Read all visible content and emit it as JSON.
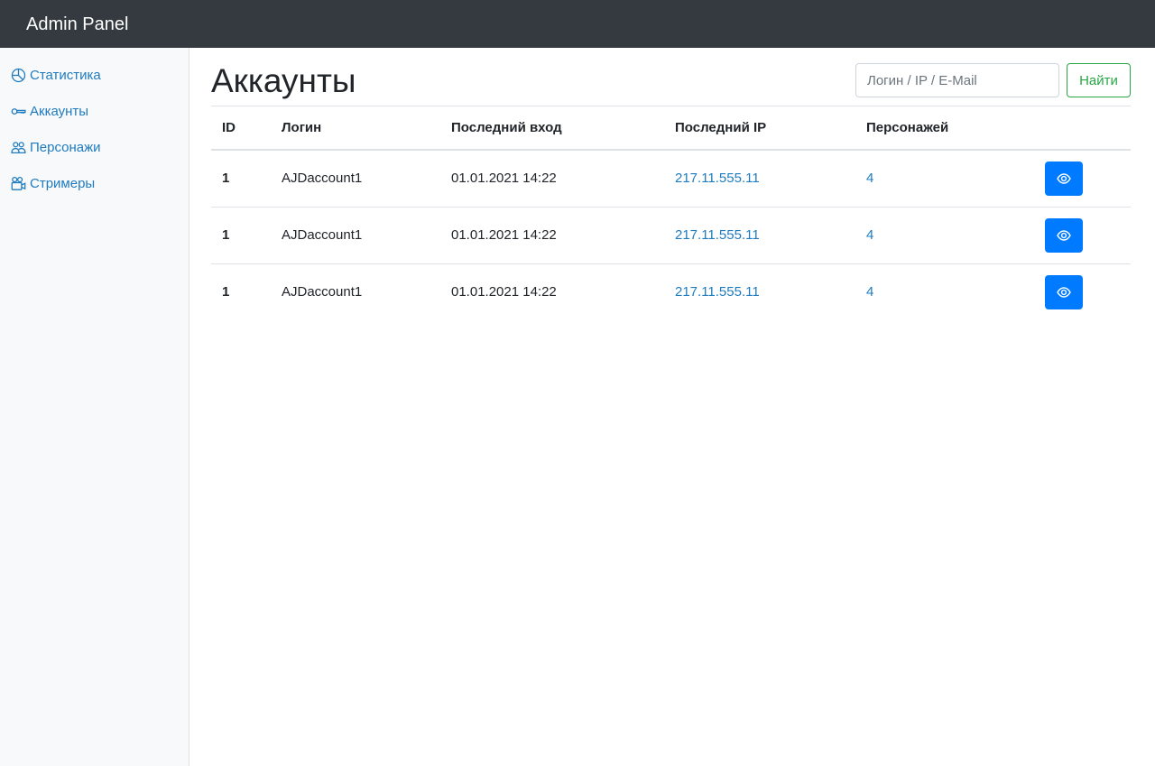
{
  "navbar": {
    "brand": "Admin Panel"
  },
  "sidebar": {
    "items": [
      {
        "label": "Статистика",
        "icon": "pie-chart-icon"
      },
      {
        "label": "Аккаунты",
        "icon": "key-icon"
      },
      {
        "label": "Персонажи",
        "icon": "people-icon"
      },
      {
        "label": "Стримеры",
        "icon": "camera-reels-icon"
      }
    ]
  },
  "main": {
    "title": "Аккаунты",
    "search": {
      "placeholder": "Логин / IP / E-Mail",
      "value": "",
      "button_label": "Найти"
    },
    "table": {
      "headers": [
        "ID",
        "Логин",
        "Последний вход",
        "Последний IP",
        "Персонажей",
        ""
      ],
      "rows": [
        {
          "id": "1",
          "login": "AJDaccount1",
          "last_login": "01.01.2021 14:22",
          "last_ip": "217.11.555.11",
          "characters": "4"
        },
        {
          "id": "1",
          "login": "AJDaccount1",
          "last_login": "01.01.2021 14:22",
          "last_ip": "217.11.555.11",
          "characters": "4"
        },
        {
          "id": "1",
          "login": "AJDaccount1",
          "last_login": "01.01.2021 14:22",
          "last_ip": "217.11.555.11",
          "characters": "4"
        }
      ]
    }
  },
  "colors": {
    "navbar_bg": "#343a40",
    "link": "#1f7bbf",
    "primary": "#007bff",
    "success": "#28a745"
  }
}
